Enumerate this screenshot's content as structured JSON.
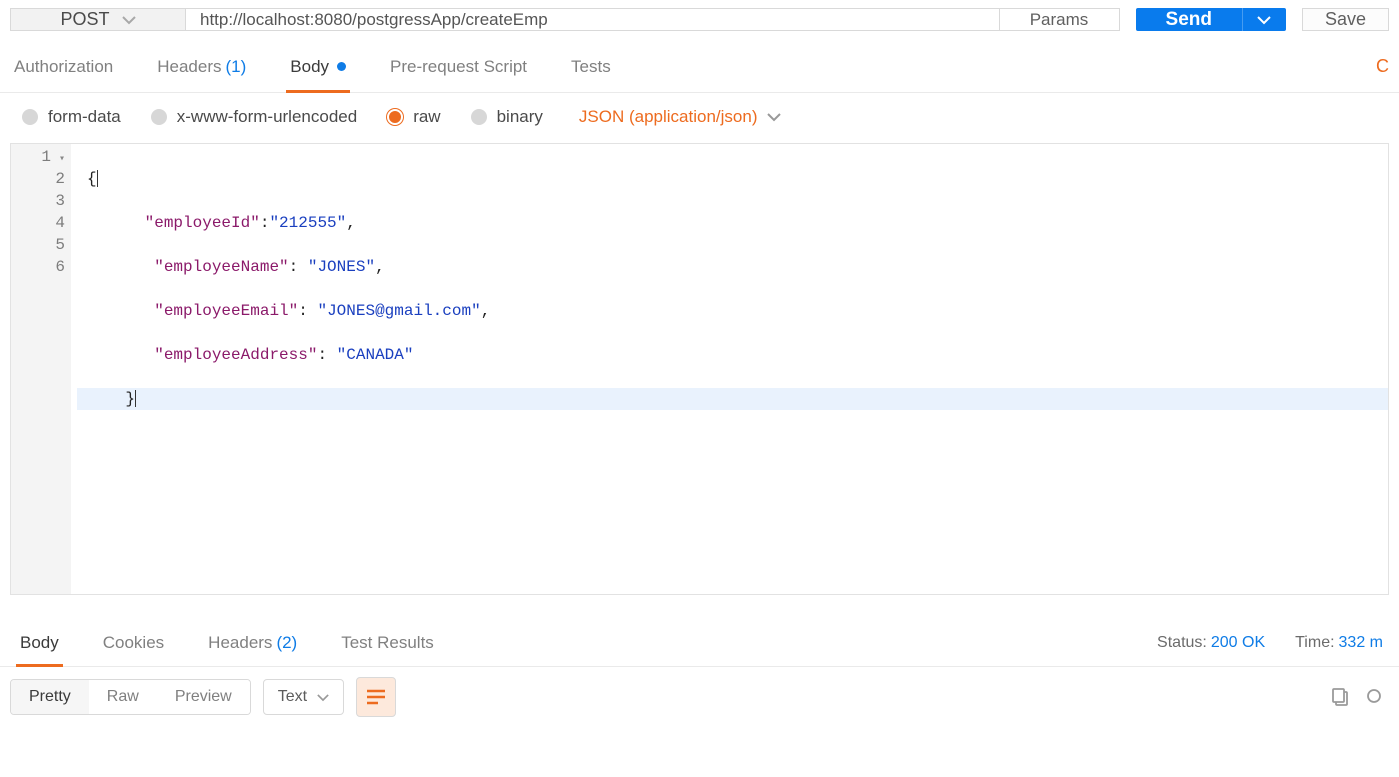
{
  "request": {
    "method": "POST",
    "url": "http://localhost:8080/postgressApp/createEmp",
    "params_label": "Params",
    "send_label": "Send",
    "save_label": "Save"
  },
  "request_tabs": {
    "authorization": "Authorization",
    "headers_label": "Headers",
    "headers_count": "(1)",
    "body": "Body",
    "pre_request": "Pre-request Script",
    "tests": "Tests",
    "overflow": "C"
  },
  "body_types": {
    "form_data": "form-data",
    "urlencoded": "x-www-form-urlencoded",
    "raw": "raw",
    "binary": "binary",
    "content_type": "JSON (application/json)"
  },
  "editor": {
    "lines": [
      "1",
      "2",
      "3",
      "4",
      "5",
      "6"
    ],
    "json": {
      "employeeId": "212555",
      "employeeName": "JONES",
      "employeeEmail": "JONES@gmail.com",
      "employeeAddress": "CANADA"
    }
  },
  "response_tabs": {
    "body": "Body",
    "cookies": "Cookies",
    "headers_label": "Headers",
    "headers_count": "(2)",
    "tests": "Test Results"
  },
  "response_meta": {
    "status_label": "Status:",
    "status_value": "200 OK",
    "time_label": "Time:",
    "time_value": "332 m"
  },
  "response_toolbar": {
    "pretty": "Pretty",
    "raw": "Raw",
    "preview": "Preview",
    "format": "Text"
  }
}
